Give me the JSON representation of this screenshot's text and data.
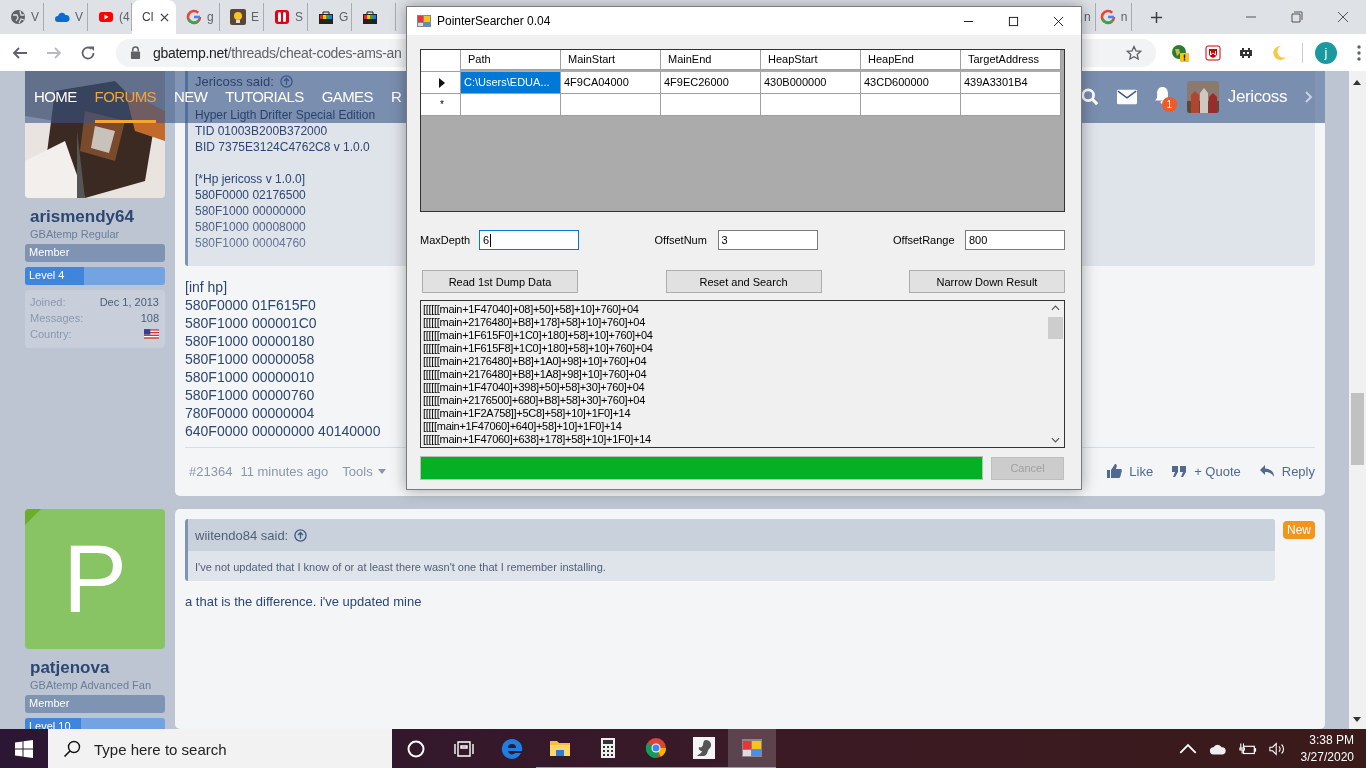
{
  "browser": {
    "tabs": [
      {
        "label": "V",
        "selected": false
      },
      {
        "label": "V",
        "selected": false
      },
      {
        "label": "(4",
        "selected": false
      },
      {
        "label": "Cl",
        "selected": true
      },
      {
        "label": "g",
        "selected": false
      },
      {
        "label": "E",
        "selected": false
      },
      {
        "label": "S",
        "selected": false
      },
      {
        "label": "G",
        "selected": false
      },
      {
        "selected": false
      }
    ],
    "more_tabs": [
      {
        "label": "n",
        "selected": false
      },
      {
        "label": "n",
        "selected": false
      }
    ],
    "url_host": "gbatemp.net",
    "url_path": "/threads/cheat-codes-ams-an",
    "profile": "j"
  },
  "site": {
    "nav": [
      {
        "label": "HOME",
        "selected": false
      },
      {
        "label": "FORUMS",
        "selected": true
      },
      {
        "label": "NEW",
        "selected": false
      },
      {
        "label": "TUTORIALS",
        "selected": false
      },
      {
        "label": "GAMES",
        "selected": false
      },
      {
        "label": "R",
        "selected": false
      }
    ],
    "notifications": "1",
    "username": "Jericoss"
  },
  "posts": [
    {
      "author": "arismendy64",
      "title": "GBAtemp Regular",
      "group": "Member",
      "level_label": "Level 4",
      "level": 0.42,
      "stats": [
        {
          "label": "Joined:",
          "value": "Dec 1, 2013"
        },
        {
          "label": "Messages:",
          "value": "108"
        },
        {
          "label": "Country:",
          "kind": "flag"
        }
      ],
      "quote": {
        "author": "Jericoss said:",
        "paragraphs": [
          [
            "Hyper Ligth Drifter Special Edition",
            "TID 01003B200B372000",
            "BID 7375E3124C4762C8 v 1.0.0"
          ],
          [
            "[*Hp jericoss v 1.0.0]",
            "580F0000 02176500",
            "580F1000 00000000",
            "580F1000 00008000",
            "580F1000 00004760"
          ]
        ]
      },
      "body": [
        "[inf hp]",
        "580F0000 01F615F0",
        "580F1000 000001C0",
        "580F1000 00000180",
        "580F1000 00000058",
        "580F1000 00000010",
        "580F1000 00000760",
        "780F0000 00000004",
        "640F0000 00000000 40140000"
      ],
      "number": "#21364",
      "time": "11 minutes ago",
      "tools": "Tools",
      "actions": [
        "Like",
        "+ Quote",
        "Reply"
      ]
    },
    {
      "avatar": {
        "kind": "letter",
        "letter": "P"
      },
      "author": "patjenova",
      "title": "GBAtemp Advanced Fan",
      "group": "Member",
      "level_label": "Level 10",
      "level": 0.4,
      "badge": "New",
      "quote": {
        "author": "wiitendo84 said:",
        "paragraphs": [
          [
            "I've not updated that I know of or at least there wasn't one that I remember installing."
          ]
        ]
      },
      "body": [
        "a that is the difference. i've updated mine"
      ]
    }
  ],
  "dialog": {
    "title": "PointerSearcher 0.04",
    "grid": {
      "columns": [
        "Path",
        "MainStart",
        "MainEnd",
        "HeapStart",
        "HeapEnd",
        "TargetAddress"
      ],
      "rows": [
        {
          "current": true,
          "cells": [
            {
              "text": "C:\\Users\\EDUA...",
              "selected": true
            },
            {
              "text": "4F9CA04000",
              "selected": false
            },
            {
              "text": "4F9EC26000",
              "selected": false
            },
            {
              "text": "430B000000",
              "selected": false
            },
            {
              "text": "43CD600000",
              "selected": false
            },
            {
              "text": "439A3301B4",
              "selected": false
            }
          ]
        }
      ],
      "new_row_marker": "*"
    },
    "fields": [
      {
        "label": "MaxDepth",
        "value": "6",
        "focused": true
      },
      {
        "label": "OffsetNum",
        "value": "3",
        "focused": false
      },
      {
        "label": "OffsetRange",
        "value": "800",
        "focused": false
      }
    ],
    "buttons": [
      {
        "label": "Read 1st Dump Data",
        "disabled": false
      },
      {
        "label": "Reset and Search",
        "disabled": false
      },
      {
        "label": "Narrow Down Result",
        "disabled": false
      }
    ],
    "results": [
      "[[[[[[main+1F47040]+08]+50]+58]+10]+760]+04",
      "[[[[[[main+2176480]+B8]+178]+58]+10]+760]+04",
      "[[[[[[main+1F615F0]+1C0]+180]+58]+10]+760]+04",
      "[[[[[[main+1F615F8]+1C0]+180]+58]+10]+760]+04",
      "[[[[[[main+2176480]+B8]+1A0]+98]+10]+760]+04",
      "[[[[[[main+2176480]+B8]+1A8]+98]+10]+760]+04",
      "[[[[[[main+1F47040]+398]+50]+58]+30]+760]+04",
      "[[[[[[main+2176500]+680]+B8]+58]+30]+760]+04",
      "[[[[[[main+1F2A758]]+5C8]+58]+10]+1F0]+14",
      "[[[[[main+1F47060]+640]+58]+10]+1F0]+14",
      "[[[[[[main+1F47060]+638]+178]+58]+10]+1F0]+14"
    ],
    "progress": {
      "level": 1
    },
    "cancel": {
      "label": "Cancel",
      "disabled": true
    }
  },
  "taskbar": {
    "search_placeholder": "Type here to search",
    "apps": [
      {
        "running": false,
        "selected": false
      },
      {
        "running": true,
        "selected": false
      },
      {
        "running": true,
        "selected": false
      },
      {
        "running": true,
        "selected": false
      },
      {
        "running": true,
        "selected": false
      },
      {
        "running": true,
        "selected": true
      }
    ],
    "time": "3:38 PM",
    "date": "3/27/2020"
  }
}
